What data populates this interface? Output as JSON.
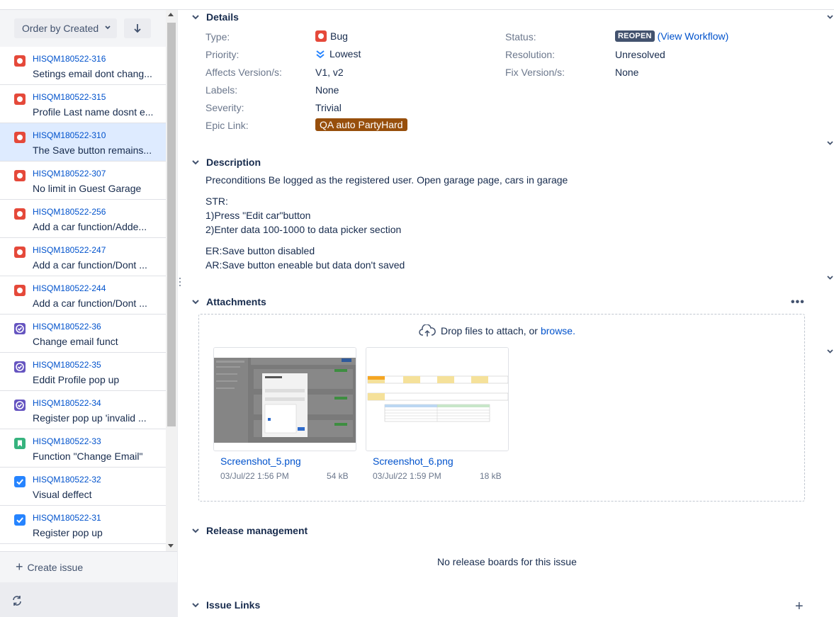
{
  "colors": {
    "link": "#0052cc",
    "bug": "#e5493a",
    "task": "#6554c0",
    "story": "#36b37e",
    "done_check": "#2684ff",
    "epic": "#974f0c",
    "status": "#42526e"
  },
  "sidebar": {
    "order_label": "Order by Created",
    "sort_icon": "arrow-down-icon",
    "create_issue_label": "Create issue",
    "items": [
      {
        "key": "HISQM180522-316",
        "summary": "Setings email dont chang...",
        "type": "bug"
      },
      {
        "key": "HISQM180522-315",
        "summary": "Profile Last name dosnt e...",
        "type": "bug"
      },
      {
        "key": "HISQM180522-310",
        "summary": "The Save button remains...",
        "type": "bug"
      },
      {
        "key": "HISQM180522-307",
        "summary": "No limit in Guest Garage",
        "type": "bug"
      },
      {
        "key": "HISQM180522-256",
        "summary": "Add a car function/Adde...",
        "type": "bug"
      },
      {
        "key": "HISQM180522-247",
        "summary": "Add a car function/Dont ...",
        "type": "bug"
      },
      {
        "key": "HISQM180522-244",
        "summary": "Add a car function/Dont ...",
        "type": "bug"
      },
      {
        "key": "HISQM180522-36",
        "summary": "Change email funct",
        "type": "task"
      },
      {
        "key": "HISQM180522-35",
        "summary": "Eddit Profile pop up",
        "type": "task"
      },
      {
        "key": "HISQM180522-34",
        "summary": "Register pop up 'invalid ...",
        "type": "task"
      },
      {
        "key": "HISQM180522-33",
        "summary": "Function \"Change Email\"",
        "type": "story"
      },
      {
        "key": "HISQM180522-32",
        "summary": "Visual deffect",
        "type": "done"
      },
      {
        "key": "HISQM180522-31",
        "summary": "Register pop up",
        "type": "done"
      }
    ]
  },
  "details": {
    "title": "Details",
    "left": [
      {
        "label": "Type:",
        "value": "Bug"
      },
      {
        "label": "Priority:",
        "value": "Lowest"
      },
      {
        "label": "Affects Version/s:",
        "value": "V1, v2"
      },
      {
        "label": "Labels:",
        "value": "None"
      },
      {
        "label": "Severity:",
        "value": "Trivial"
      },
      {
        "label": "Epic Link:",
        "value": "QA auto PartyHard"
      }
    ],
    "right": [
      {
        "label": "Status:",
        "value": "REOPEN",
        "extra": "(View Workflow)"
      },
      {
        "label": "Resolution:",
        "value": "Unresolved"
      },
      {
        "label": "Fix Version/s:",
        "value": "None"
      }
    ]
  },
  "description": {
    "title": "Description",
    "lines": [
      "Preconditions Be logged as the registered user. Open garage page, cars in garage",
      "STR:",
      "1)Press \"Edit car\"button",
      "2)Enter data 100-1000 to data picker section",
      "ER:Save button disabled",
      "AR:Save button eneable but data don't saved"
    ]
  },
  "attachments": {
    "title": "Attachments",
    "more_label": "•••",
    "drop_text": "Drop files to attach, or",
    "browse_label": "browse.",
    "files": [
      {
        "name": "Screenshot_5.png",
        "date": "03/Jul/22 1:56 PM",
        "size": "54 kB"
      },
      {
        "name": "Screenshot_6.png",
        "date": "03/Jul/22 1:59 PM",
        "size": "18 kB"
      }
    ]
  },
  "release": {
    "title": "Release management",
    "empty_text": "No release boards for this issue"
  },
  "issue_links": {
    "title": "Issue Links",
    "add_label": "+"
  }
}
